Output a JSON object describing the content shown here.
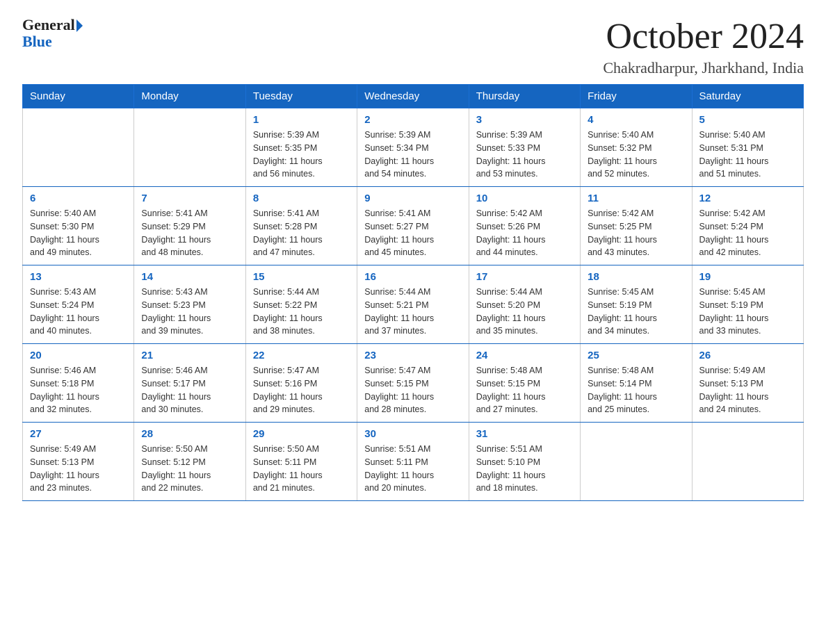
{
  "header": {
    "logo_general": "General",
    "logo_blue": "Blue",
    "month_title": "October 2024",
    "location": "Chakradharpur, Jharkhand, India"
  },
  "days_of_week": [
    "Sunday",
    "Monday",
    "Tuesday",
    "Wednesday",
    "Thursday",
    "Friday",
    "Saturday"
  ],
  "weeks": [
    [
      {
        "day": "",
        "info": ""
      },
      {
        "day": "",
        "info": ""
      },
      {
        "day": "1",
        "info": "Sunrise: 5:39 AM\nSunset: 5:35 PM\nDaylight: 11 hours\nand 56 minutes."
      },
      {
        "day": "2",
        "info": "Sunrise: 5:39 AM\nSunset: 5:34 PM\nDaylight: 11 hours\nand 54 minutes."
      },
      {
        "day": "3",
        "info": "Sunrise: 5:39 AM\nSunset: 5:33 PM\nDaylight: 11 hours\nand 53 minutes."
      },
      {
        "day": "4",
        "info": "Sunrise: 5:40 AM\nSunset: 5:32 PM\nDaylight: 11 hours\nand 52 minutes."
      },
      {
        "day": "5",
        "info": "Sunrise: 5:40 AM\nSunset: 5:31 PM\nDaylight: 11 hours\nand 51 minutes."
      }
    ],
    [
      {
        "day": "6",
        "info": "Sunrise: 5:40 AM\nSunset: 5:30 PM\nDaylight: 11 hours\nand 49 minutes."
      },
      {
        "day": "7",
        "info": "Sunrise: 5:41 AM\nSunset: 5:29 PM\nDaylight: 11 hours\nand 48 minutes."
      },
      {
        "day": "8",
        "info": "Sunrise: 5:41 AM\nSunset: 5:28 PM\nDaylight: 11 hours\nand 47 minutes."
      },
      {
        "day": "9",
        "info": "Sunrise: 5:41 AM\nSunset: 5:27 PM\nDaylight: 11 hours\nand 45 minutes."
      },
      {
        "day": "10",
        "info": "Sunrise: 5:42 AM\nSunset: 5:26 PM\nDaylight: 11 hours\nand 44 minutes."
      },
      {
        "day": "11",
        "info": "Sunrise: 5:42 AM\nSunset: 5:25 PM\nDaylight: 11 hours\nand 43 minutes."
      },
      {
        "day": "12",
        "info": "Sunrise: 5:42 AM\nSunset: 5:24 PM\nDaylight: 11 hours\nand 42 minutes."
      }
    ],
    [
      {
        "day": "13",
        "info": "Sunrise: 5:43 AM\nSunset: 5:24 PM\nDaylight: 11 hours\nand 40 minutes."
      },
      {
        "day": "14",
        "info": "Sunrise: 5:43 AM\nSunset: 5:23 PM\nDaylight: 11 hours\nand 39 minutes."
      },
      {
        "day": "15",
        "info": "Sunrise: 5:44 AM\nSunset: 5:22 PM\nDaylight: 11 hours\nand 38 minutes."
      },
      {
        "day": "16",
        "info": "Sunrise: 5:44 AM\nSunset: 5:21 PM\nDaylight: 11 hours\nand 37 minutes."
      },
      {
        "day": "17",
        "info": "Sunrise: 5:44 AM\nSunset: 5:20 PM\nDaylight: 11 hours\nand 35 minutes."
      },
      {
        "day": "18",
        "info": "Sunrise: 5:45 AM\nSunset: 5:19 PM\nDaylight: 11 hours\nand 34 minutes."
      },
      {
        "day": "19",
        "info": "Sunrise: 5:45 AM\nSunset: 5:19 PM\nDaylight: 11 hours\nand 33 minutes."
      }
    ],
    [
      {
        "day": "20",
        "info": "Sunrise: 5:46 AM\nSunset: 5:18 PM\nDaylight: 11 hours\nand 32 minutes."
      },
      {
        "day": "21",
        "info": "Sunrise: 5:46 AM\nSunset: 5:17 PM\nDaylight: 11 hours\nand 30 minutes."
      },
      {
        "day": "22",
        "info": "Sunrise: 5:47 AM\nSunset: 5:16 PM\nDaylight: 11 hours\nand 29 minutes."
      },
      {
        "day": "23",
        "info": "Sunrise: 5:47 AM\nSunset: 5:15 PM\nDaylight: 11 hours\nand 28 minutes."
      },
      {
        "day": "24",
        "info": "Sunrise: 5:48 AM\nSunset: 5:15 PM\nDaylight: 11 hours\nand 27 minutes."
      },
      {
        "day": "25",
        "info": "Sunrise: 5:48 AM\nSunset: 5:14 PM\nDaylight: 11 hours\nand 25 minutes."
      },
      {
        "day": "26",
        "info": "Sunrise: 5:49 AM\nSunset: 5:13 PM\nDaylight: 11 hours\nand 24 minutes."
      }
    ],
    [
      {
        "day": "27",
        "info": "Sunrise: 5:49 AM\nSunset: 5:13 PM\nDaylight: 11 hours\nand 23 minutes."
      },
      {
        "day": "28",
        "info": "Sunrise: 5:50 AM\nSunset: 5:12 PM\nDaylight: 11 hours\nand 22 minutes."
      },
      {
        "day": "29",
        "info": "Sunrise: 5:50 AM\nSunset: 5:11 PM\nDaylight: 11 hours\nand 21 minutes."
      },
      {
        "day": "30",
        "info": "Sunrise: 5:51 AM\nSunset: 5:11 PM\nDaylight: 11 hours\nand 20 minutes."
      },
      {
        "day": "31",
        "info": "Sunrise: 5:51 AM\nSunset: 5:10 PM\nDaylight: 11 hours\nand 18 minutes."
      },
      {
        "day": "",
        "info": ""
      },
      {
        "day": "",
        "info": ""
      }
    ]
  ]
}
